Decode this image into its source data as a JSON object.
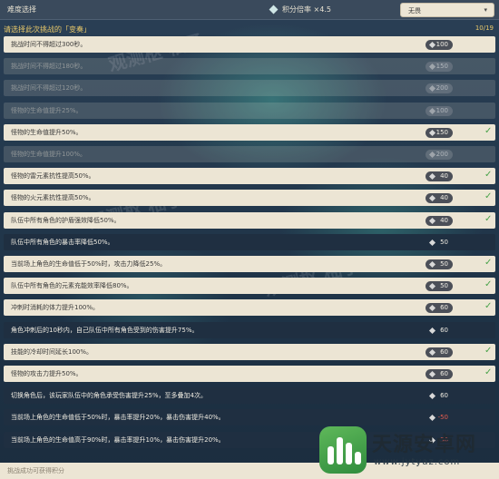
{
  "header": {
    "title": "难度选择",
    "ratio_label": "积分倍率 ×4.5",
    "difficulty_select": {
      "selected": "无畏",
      "caret": "▾"
    }
  },
  "subheader": {
    "label": "请选择此次挑战的「变奏」",
    "count": "10/19"
  },
  "rows": [
    {
      "text": "挑战时间不得超过300秒。",
      "value": "100",
      "state": "light",
      "checked": false
    },
    {
      "text": "挑战时间不得超过180秒。",
      "value": "150",
      "state": "faded",
      "checked": false
    },
    {
      "text": "挑战时间不得超过120秒。",
      "value": "200",
      "state": "faded",
      "checked": false
    },
    {
      "text": "怪物的生命值提升25%。",
      "value": "100",
      "state": "faded",
      "checked": false
    },
    {
      "text": "怪物的生命值提升50%。",
      "value": "150",
      "state": "light",
      "checked": true
    },
    {
      "text": "怪物的生命值提升100%。",
      "value": "200",
      "state": "faded",
      "checked": false
    },
    {
      "text": "怪物的雷元素抗性提高50%。",
      "value": "40",
      "state": "light",
      "checked": true
    },
    {
      "text": "怪物的火元素抗性提高50%。",
      "value": "40",
      "state": "light",
      "checked": true
    },
    {
      "text": "队伍中所有角色的护盾强效降低50%。",
      "value": "40",
      "state": "light",
      "checked": true
    },
    {
      "text": "队伍中所有角色的暴击率降低50%。",
      "value": "50",
      "state": "dark",
      "checked": false
    },
    {
      "text": "当前场上角色的生命值低于50%时，攻击力降低25%。",
      "value": "50",
      "state": "light",
      "checked": true
    },
    {
      "text": "队伍中所有角色的元素充能效率降低80%。",
      "value": "50",
      "state": "light",
      "checked": true
    },
    {
      "text": "冲刺时消耗的体力提升100%。",
      "value": "60",
      "state": "light",
      "checked": true
    },
    {
      "text": "角色冲刺后的10秒内，自己队伍中所有角色受到的伤害提升75%。",
      "value": "60",
      "state": "dark",
      "checked": false
    },
    {
      "text": "技能的冷却时间延长100%。",
      "value": "60",
      "state": "light",
      "checked": true
    },
    {
      "text": "怪物的攻击力提升50%。",
      "value": "60",
      "state": "light",
      "checked": true
    },
    {
      "text": "切换角色后，该玩家队伍中的角色承受伤害提升25%，至多叠加4次。",
      "value": "60",
      "state": "dark",
      "checked": false
    },
    {
      "text": "当前场上角色的生命值低于50%时，暴击率提升20%，暴击伤害提升40%。",
      "value": "-50",
      "state": "dark",
      "checked": false,
      "negative": true
    },
    {
      "text": "当前场上角色的生命值高于90%时，暴击率提升10%，暴击伤害提升20%。",
      "value": "-50",
      "state": "dark",
      "checked": false,
      "negative": true
    }
  ],
  "footer": {
    "text": "挑战成功可获得积分"
  },
  "watermarks": [
    "观测枢 柚子",
    "观测枢 柚子",
    "观测枢 柚子"
  ],
  "logo": {
    "name": "天源安卓网",
    "url": "www.jytyaz.com"
  },
  "icons": {
    "check": "check-icon",
    "gem": "gem-icon"
  },
  "colors": {
    "accent": "#e8c86a",
    "check": "#4aa34a",
    "negative": "#e45c4e"
  }
}
